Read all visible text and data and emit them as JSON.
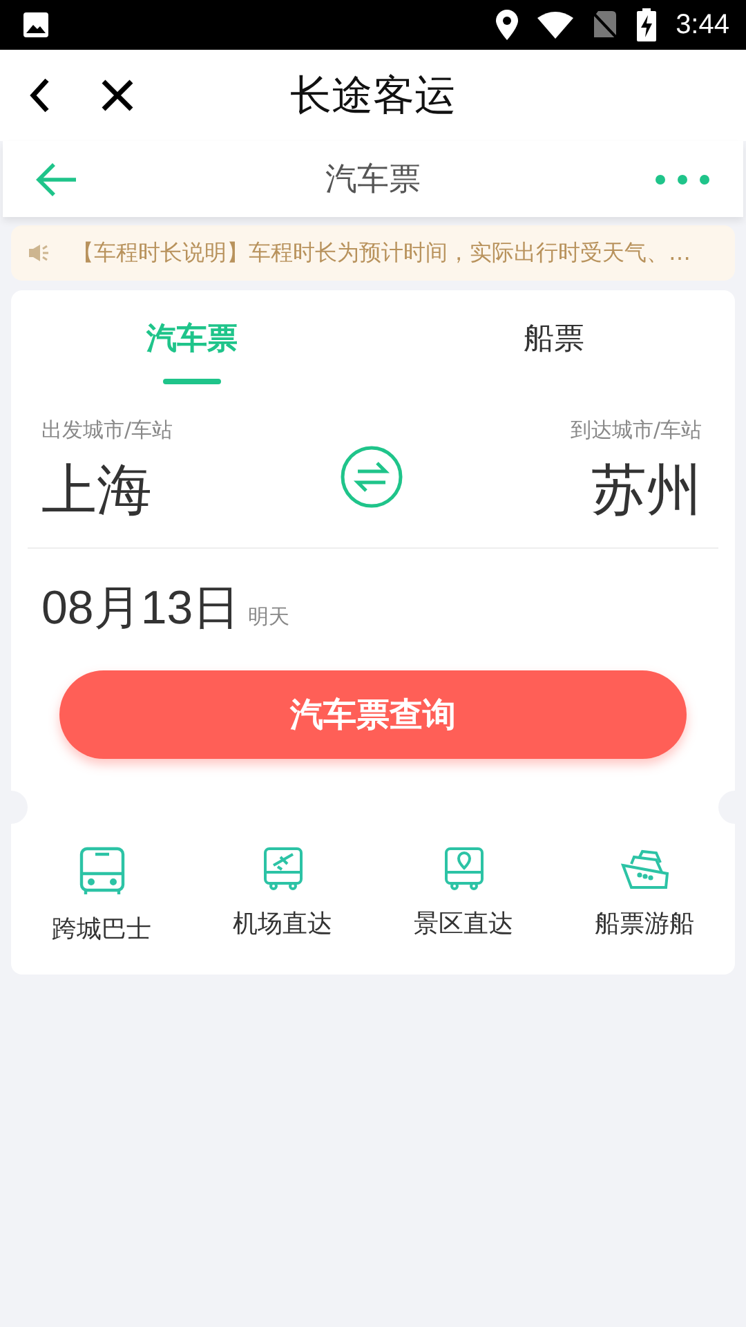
{
  "status_bar": {
    "time": "3:44"
  },
  "header": {
    "title": "长途客运"
  },
  "sub_nav": {
    "title": "汽车票"
  },
  "notice": {
    "text": "【车程时长说明】车程时长为预计时间，实际出行时受天气、…"
  },
  "tabs": [
    {
      "label": "汽车票",
      "selected": true
    },
    {
      "label": "船票",
      "selected": false
    }
  ],
  "route": {
    "from_label": "出发城市/车站",
    "from": "上海",
    "to_label": "到达城市/车站",
    "to": "苏州"
  },
  "date": {
    "value": "08月13日",
    "hint": "明天"
  },
  "search_button": "汽车票查询",
  "services": [
    {
      "kind": "bus",
      "label": "跨城巴士"
    },
    {
      "kind": "airport",
      "label": "机场直达"
    },
    {
      "kind": "scenic",
      "label": "景区直达"
    },
    {
      "kind": "ship",
      "label": "船票游船"
    }
  ]
}
